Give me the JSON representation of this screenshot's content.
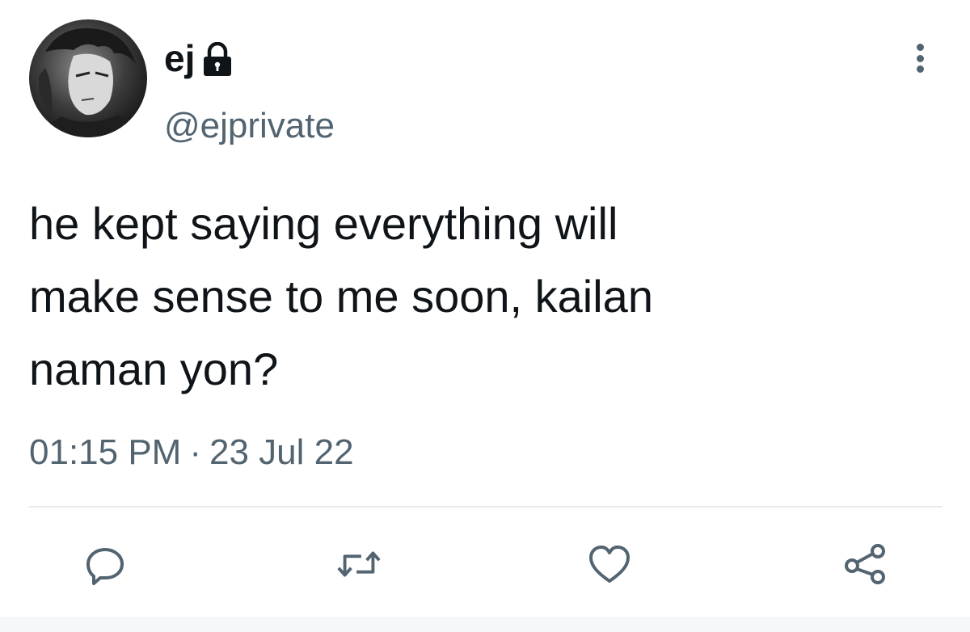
{
  "user": {
    "display_name": "ej",
    "handle": "@ejprivate",
    "avatar_icon": "avatar-image",
    "locked_icon": "lock-icon"
  },
  "tweet": {
    "text": "he kept saying everything will\nmake sense to me soon, kailan\nnaman yon?",
    "time": "01:15 PM",
    "separator": "·",
    "date": "23 Jul 22"
  },
  "actions": {
    "reply_icon": "reply-icon",
    "retweet_icon": "retweet-icon",
    "like_icon": "heart-icon",
    "share_icon": "share-icon"
  },
  "menu_icon": "more-options-icon",
  "colors": {
    "primary_text": "#0f1419",
    "secondary_text": "#536471",
    "divider": "#e7eaec",
    "background": "#ffffff"
  }
}
